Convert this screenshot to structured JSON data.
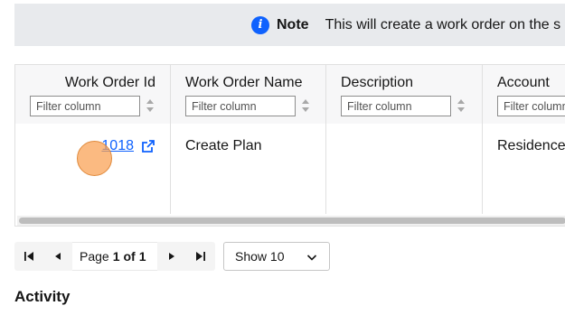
{
  "note": {
    "icon": "info-icon",
    "icon_glyph": "i",
    "title": "Note",
    "text": "This will create a work order on the s"
  },
  "table": {
    "columns": [
      {
        "label": "Work Order Id",
        "filter_placeholder": "Filter column"
      },
      {
        "label": "Work Order Name",
        "filter_placeholder": "Filter column"
      },
      {
        "label": "Description",
        "filter_placeholder": "Filter column"
      },
      {
        "label": "Account",
        "filter_placeholder": "Filter column"
      }
    ],
    "rows": [
      {
        "work_order_id": "1018",
        "work_order_name": "Create Plan",
        "description": "",
        "account": "Residence"
      }
    ]
  },
  "pagination": {
    "page_prefix": "Page",
    "current_page": "1",
    "of_label": "of",
    "total_pages": "1",
    "page_size_label": "Show 10"
  },
  "activity": {
    "title": "Activity"
  },
  "colors": {
    "accent": "#0f62fe",
    "note_bg": "#e8eaed",
    "click_marker": "#faa050"
  }
}
